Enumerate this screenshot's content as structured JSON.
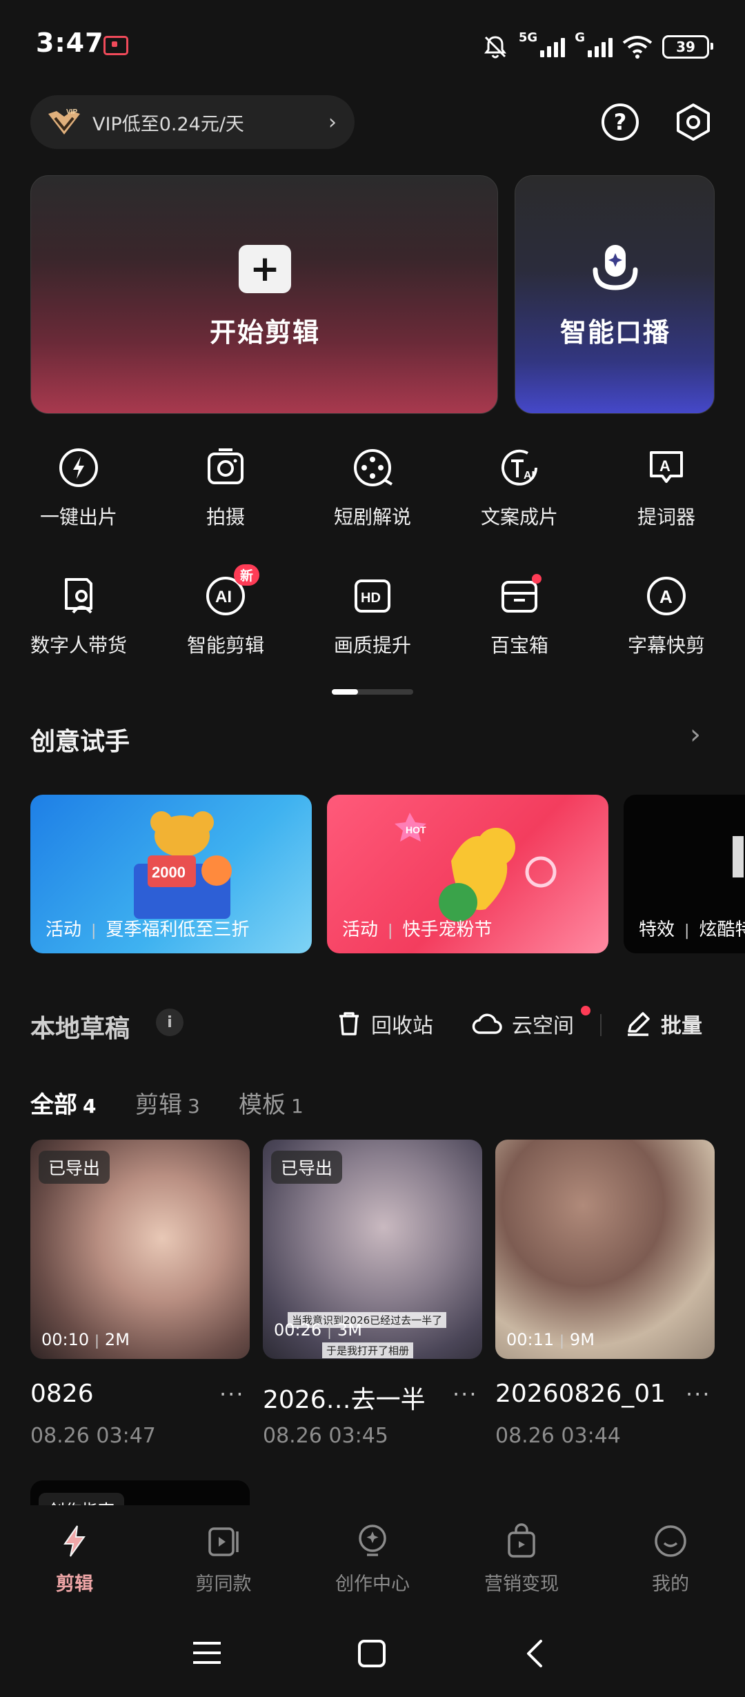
{
  "status": {
    "time": "3:47",
    "battery": "39",
    "net1": "5G",
    "net2": "G"
  },
  "header": {
    "vip_text": "VIP低至0.24元/天",
    "vip_badge": "VIP",
    "help_icon": "question-circle-icon",
    "settings_icon": "hexagon-settings-icon"
  },
  "hero": {
    "edit_label": "开始剪辑",
    "voice_label": "智能口播"
  },
  "tools_row1": [
    "一键出片",
    "拍摄",
    "短剧解说",
    "文案成片",
    "提词器"
  ],
  "tools_row2": [
    "数字人带货",
    "智能剪辑",
    "画质提升",
    "百宝箱",
    "字幕快剪"
  ],
  "badges": {
    "new": "新"
  },
  "creative": {
    "title": "创意试手",
    "cards": [
      {
        "tag": "活动",
        "text": "夏季福利低至三折",
        "art": "2000"
      },
      {
        "tag": "活动",
        "text": "快手宠粉节",
        "art": "HOT"
      },
      {
        "tag": "特效",
        "text": "炫酷特"
      }
    ]
  },
  "drafts": {
    "title": "本地草稿",
    "recycle": "回收站",
    "cloud": "云空间",
    "batch": "批量",
    "tabs": [
      {
        "label": "全部",
        "count": "4"
      },
      {
        "label": "剪辑",
        "count": "3"
      },
      {
        "label": "模板",
        "count": "1"
      }
    ],
    "items": [
      {
        "chip": "已导出",
        "duration": "00:10",
        "size": "2M",
        "title": "0826",
        "date": "08.26 03:47"
      },
      {
        "chip": "已导出",
        "duration": "00:26",
        "size": "3M",
        "title": "2026…去一半",
        "date": "08.26 03:45",
        "cap1": "当我意识到2026已经过去一半了",
        "cap2": "于是我打开了相册"
      },
      {
        "chip": "",
        "duration": "00:11",
        "size": "9M",
        "title": "20260826_01",
        "date": "08.26 03:44"
      }
    ],
    "guide_chip": "创作指南"
  },
  "nav": [
    "剪辑",
    "剪同款",
    "创作中心",
    "营销变现",
    "我的"
  ],
  "colors": {
    "accent": "#f0a7a8",
    "bg": "#141414",
    "red": "#ff3c56"
  }
}
